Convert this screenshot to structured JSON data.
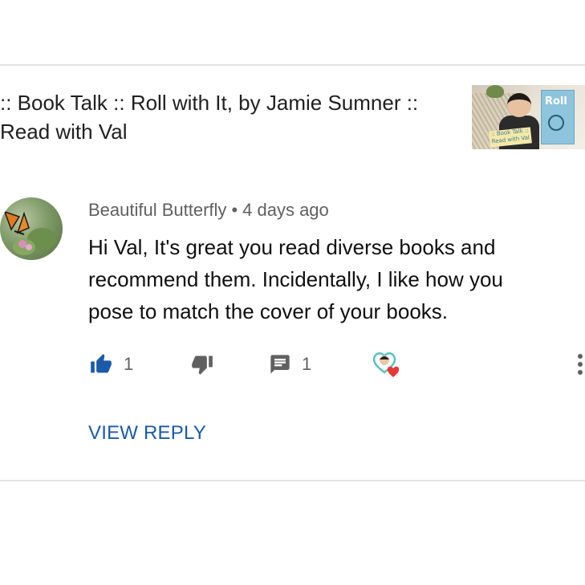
{
  "video": {
    "title": ":: Book Talk :: Roll with It, by Jamie Sumner ::\nRead with Val",
    "thumbnail": {
      "sign_text": ":: Book Talk ::\nRead with Val",
      "book_title": "Roll"
    }
  },
  "comment": {
    "author": "Beautiful Butterfly",
    "separator": "•",
    "time": "4 days ago",
    "text": "Hi Val,  It's great you read diverse books  and\nrecommend them.   Incidentally,  I like how you\npose to match the cover of your books.",
    "actions": {
      "like_count": "1",
      "reply_count": "1"
    },
    "view_reply_label": "VIEW REPLY"
  },
  "icons": {
    "like": "thumb-up-icon",
    "dislike": "thumb-down-icon",
    "reply": "comment-icon",
    "creator_heart": "creator-heart-icon",
    "more": "more-vert-icon"
  },
  "colors": {
    "like_active": "#1a5aa8",
    "icon_gray": "#606060",
    "link_blue": "#1a5aa8",
    "heart_red": "#e53935",
    "divider": "#e3e3e3"
  }
}
